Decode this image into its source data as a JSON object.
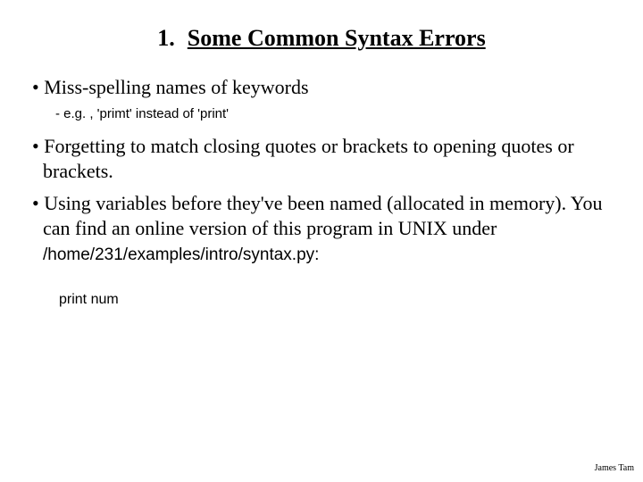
{
  "title": {
    "number": "1.",
    "text": "Some Common Syntax Errors"
  },
  "bullets": {
    "b1": "Miss-spelling names of keywords",
    "sub1": "- e.g. , 'primt' instead of 'print'",
    "b2": "Forgetting to match closing quotes or brackets to opening quotes or brackets.",
    "b3_pre": "Using variables before they've been named (allocated in memory). You can find an online version of this program in UNIX under ",
    "b3_code": "/home/231/examples/intro/syntax.py:"
  },
  "snippet": "print num",
  "footer": "James Tam"
}
